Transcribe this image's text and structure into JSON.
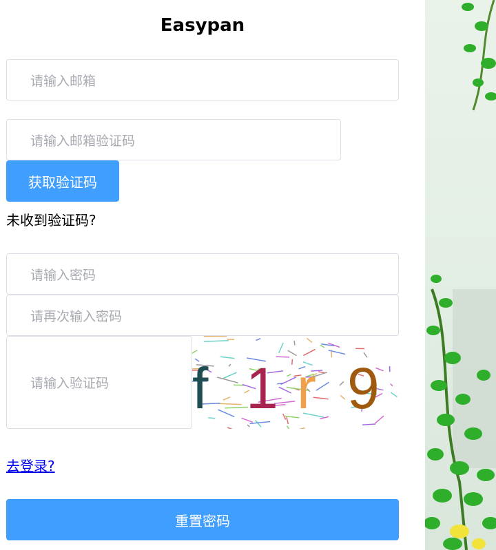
{
  "app": {
    "title": "Easypan"
  },
  "form": {
    "email_placeholder": "请输入邮箱",
    "email_code_placeholder": "请输入邮箱验证码",
    "get_code_button": "获取验证码",
    "not_received_text": "未收到验证码?",
    "password_placeholder": "请输入密码",
    "password_repeat_placeholder": "请再次输入密码",
    "captcha_placeholder": "请输入验证码",
    "captcha_chars": [
      "f",
      "1",
      "r",
      "9"
    ],
    "login_link": "去登录?",
    "reset_button": "重置密码"
  },
  "colors": {
    "accent": "#409eff",
    "border": "#dcdfe6",
    "placeholder": "#a8abb2",
    "captcha_chars": [
      "#1f4e52",
      "#a8234f",
      "#f0a04a",
      "#a05a10"
    ]
  }
}
